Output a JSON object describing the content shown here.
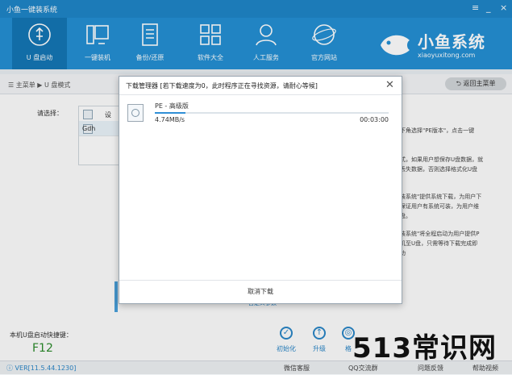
{
  "window": {
    "title": "小鱼一键装系统",
    "controls": [
      "≡",
      "_",
      "×"
    ]
  },
  "nav": {
    "items": [
      {
        "label": "U 盘启动",
        "icon": "usb-icon",
        "active": true
      },
      {
        "label": "一键装机",
        "icon": "desktop-icon"
      },
      {
        "label": "备份/还原",
        "icon": "document-icon"
      },
      {
        "label": "软件大全",
        "icon": "apps-grid-icon"
      },
      {
        "label": "人工服务",
        "icon": "user-support-icon"
      },
      {
        "label": "官方网站",
        "icon": "globe-icon"
      }
    ],
    "logo": {
      "name": "小鱼系统",
      "url": "xiaoyuxitong.com"
    }
  },
  "breadcrumb": {
    "text": "☰ 主菜单 ▶ U 盘模式",
    "back_label": "返回主菜单"
  },
  "main": {
    "select_label": "请选择：",
    "list_rows": [
      "设",
      "Gdh"
    ],
    "right_texts": [
      "下角选择\"PE版本\"，点击一键",
      "式，如果用户想保存U盘数据，就",
      "丢失数据，否则选择格式化U盘",
      "装系统\"提供系统下载，为用户下",
      "保证用户有系统可装，为用户维",
      "盘。",
      "装系统\"将全程启动为用户提供P",
      "机至U盘，只需等待下载完成即",
      "功"
    ],
    "advanced_link": "自定义参数",
    "hotkey_label": "本机U盘启动快捷键：",
    "hotkey_value": "F12",
    "tools": [
      {
        "label": "初始化",
        "icon": "check-circle-icon",
        "glyph": "✓"
      },
      {
        "label": "升级",
        "icon": "arrow-up-circle-icon",
        "glyph": "↑"
      },
      {
        "label": "格",
        "icon": "format-icon",
        "glyph": "◎"
      }
    ]
  },
  "statusbar": {
    "version": "VER[11.5.44.1230]",
    "items": [
      "微信客服",
      "QQ交流群",
      "问题反馈",
      "帮助视频"
    ]
  },
  "watermark": "513常识网",
  "download_dialog": {
    "title": "下载管理器 [若下载速度为0，此时程序正在寻找资源，请耐心等候]",
    "item_name": "PE - 高级版",
    "progress_fraction": 0.13,
    "speed": "4.74MB/s",
    "elapsed": "00:03:00",
    "cancel_label": "取消下载"
  }
}
